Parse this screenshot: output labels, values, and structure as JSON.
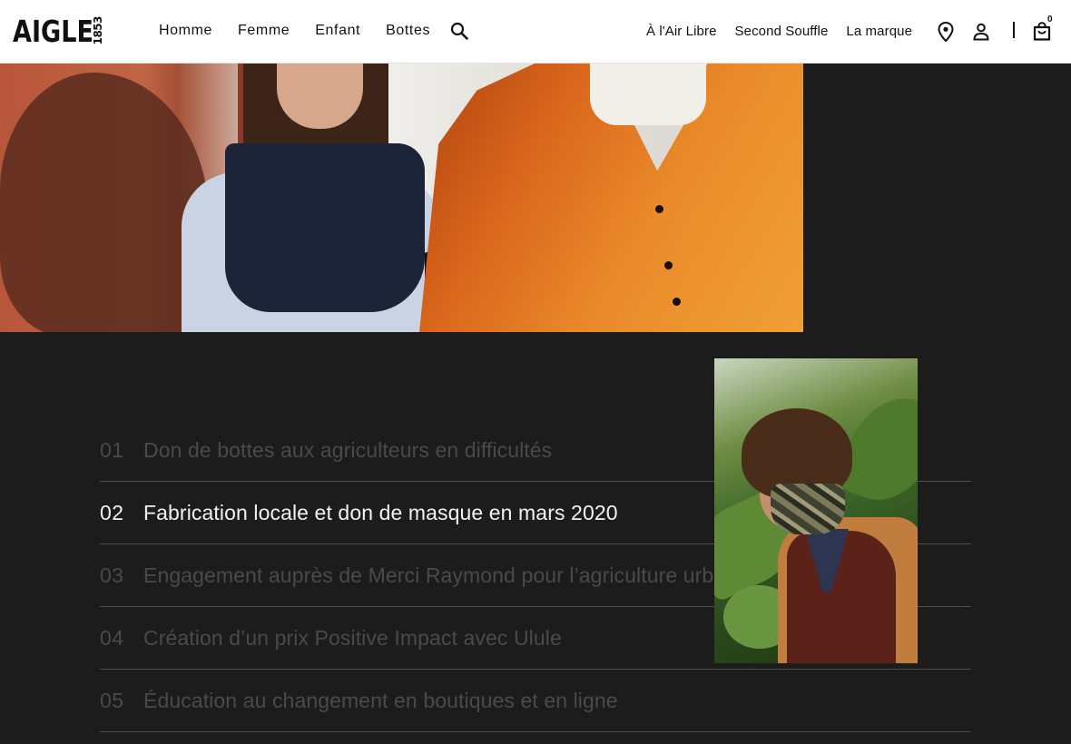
{
  "header": {
    "logo_text": "AIGLE",
    "logo_year": "1853",
    "nav_left": [
      "Homme",
      "Femme",
      "Enfant",
      "Bottes"
    ],
    "nav_right": [
      "À l'Air Libre",
      "Second Souffle",
      "La marque"
    ],
    "cart_count": "0",
    "icons": [
      "search-icon",
      "location-pin-icon",
      "user-icon",
      "shopping-bag-icon"
    ]
  },
  "engagements": [
    {
      "num": "01",
      "title": "Don de bottes aux agriculteurs en difficultés",
      "active": false
    },
    {
      "num": "02",
      "title": "Fabrication locale et don de masque en mars 2020",
      "active": true
    },
    {
      "num": "03",
      "title": "Engagement auprès de Merci Raymond pour l’agriculture urbaine",
      "active": false
    },
    {
      "num": "04",
      "title": "Création d’un prix Positive Impact avec Ulule",
      "active": false
    },
    {
      "num": "05",
      "title": "Éducation au changement en boutiques et en ligne",
      "active": false
    }
  ],
  "colors": {
    "background": "#1c1c1c",
    "active_text": "#f2f2f2",
    "inactive_text": "#4a4a4a",
    "divider": "#4d4d4d"
  }
}
